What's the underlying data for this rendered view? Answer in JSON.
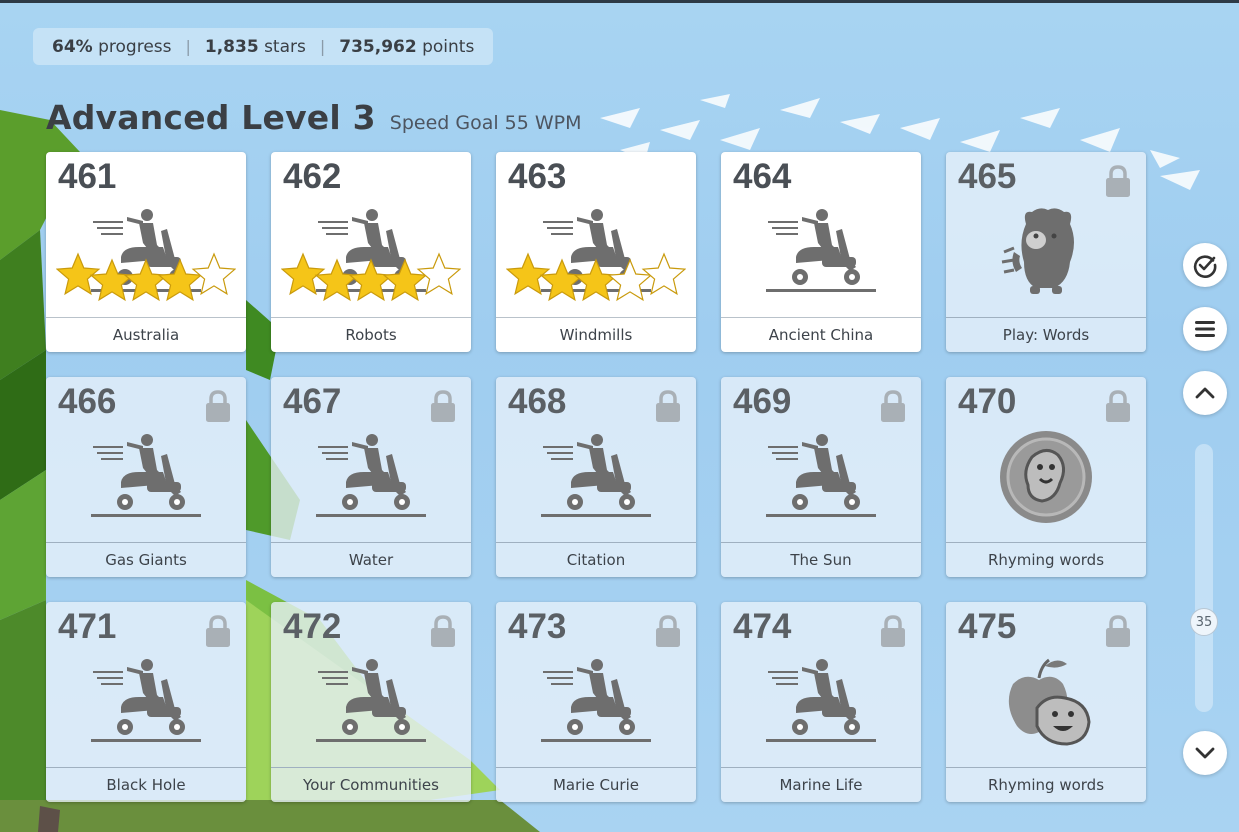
{
  "stats": {
    "progress_value": "64%",
    "progress_label": "progress",
    "stars_value": "1,835",
    "stars_label": "stars",
    "points_value": "735,962",
    "points_label": "points",
    "separator": "|"
  },
  "heading": {
    "title": "Advanced Level 3",
    "goal": "Speed Goal 55 WPM"
  },
  "lessons": [
    {
      "number": "461",
      "name": "Australia",
      "locked": false,
      "stars": 5,
      "stars_earned": 4,
      "icon": "scooter-icon"
    },
    {
      "number": "462",
      "name": "Robots",
      "locked": false,
      "stars": 5,
      "stars_earned": 4,
      "icon": "scooter-icon"
    },
    {
      "number": "463",
      "name": "Windmills",
      "locked": false,
      "stars": 5,
      "stars_earned": 3,
      "icon": "scooter-icon"
    },
    {
      "number": "464",
      "name": "Ancient China",
      "locked": false,
      "stars": 0,
      "stars_earned": 0,
      "icon": "scooter-icon"
    },
    {
      "number": "465",
      "name": "Play: Words",
      "locked": true,
      "stars": 0,
      "stars_earned": 0,
      "icon": "monster-game-icon"
    },
    {
      "number": "466",
      "name": "Gas Giants",
      "locked": true,
      "stars": 0,
      "stars_earned": 0,
      "icon": "scooter-icon"
    },
    {
      "number": "467",
      "name": "Water",
      "locked": true,
      "stars": 0,
      "stars_earned": 0,
      "icon": "scooter-icon"
    },
    {
      "number": "468",
      "name": "Citation",
      "locked": true,
      "stars": 0,
      "stars_earned": 0,
      "icon": "scooter-icon"
    },
    {
      "number": "469",
      "name": "The Sun",
      "locked": true,
      "stars": 0,
      "stars_earned": 0,
      "icon": "scooter-icon"
    },
    {
      "number": "470",
      "name": "Rhyming words",
      "locked": true,
      "stars": 0,
      "stars_earned": 0,
      "icon": "creature-coin-icon"
    },
    {
      "number": "471",
      "name": "Black Hole",
      "locked": true,
      "stars": 0,
      "stars_earned": 0,
      "icon": "scooter-icon"
    },
    {
      "number": "472",
      "name": "Your Communities",
      "locked": true,
      "stars": 0,
      "stars_earned": 0,
      "icon": "scooter-icon"
    },
    {
      "number": "473",
      "name": "Marie Curie",
      "locked": true,
      "stars": 0,
      "stars_earned": 0,
      "icon": "scooter-icon"
    },
    {
      "number": "474",
      "name": "Marine Life",
      "locked": true,
      "stars": 0,
      "stars_earned": 0,
      "icon": "scooter-icon"
    },
    {
      "number": "475",
      "name": "Rhyming words",
      "locked": true,
      "stars": 0,
      "stars_earned": 0,
      "icon": "apple-creature-icon"
    }
  ],
  "sidebar": {
    "buttons": [
      "check-circle-icon",
      "menu-icon",
      "chevron-up-icon",
      "chevron-down-icon"
    ],
    "scroll_level": "35"
  },
  "colors": {
    "star_filled": "#f5c518",
    "star_empty": "#ffffff",
    "icon_gray": "#6e6e6e",
    "text_dark": "#3b3f44"
  }
}
